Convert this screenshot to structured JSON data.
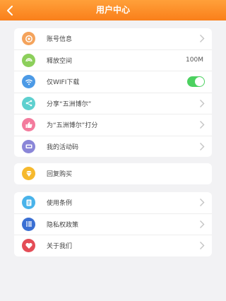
{
  "header": {
    "title": "用户中心"
  },
  "group1": {
    "items": [
      {
        "label": "账号信息"
      },
      {
        "label": "释放空间",
        "value": "100M"
      },
      {
        "label": "仅WIFI下载",
        "toggle_on": true
      },
      {
        "label": "分享“五洲博尔”"
      },
      {
        "label": "为“五洲博尔”打分"
      },
      {
        "label": "我的活动码"
      }
    ]
  },
  "group2": {
    "items": [
      {
        "label": "回复购买"
      }
    ]
  },
  "group3": {
    "items": [
      {
        "label": "使用条例"
      },
      {
        "label": "隐私权政策"
      },
      {
        "label": "关于我们"
      }
    ]
  },
  "colors": {
    "header": "#fa8b22",
    "account": "#f4a35c",
    "storage": "#8ccf5b",
    "wifi": "#4c9ae6",
    "share": "#5ed0cf",
    "rate": "#f37b9d",
    "activity": "#8a86d8",
    "restore": "#f6b92d",
    "terms": "#49b3ea",
    "privacy": "#3a6fd3",
    "about": "#e44d57",
    "toggle": "#4cd160"
  },
  "icons": {
    "back": "chevron-left-icon",
    "account": "account-icon",
    "storage": "storage-icon",
    "wifi": "wifi-icon",
    "share": "share-icon",
    "rate": "thumb-up-icon",
    "activity": "ticket-icon",
    "restore": "diamond-icon",
    "terms": "document-icon",
    "privacy": "list-icon",
    "about": "heart-icon"
  }
}
